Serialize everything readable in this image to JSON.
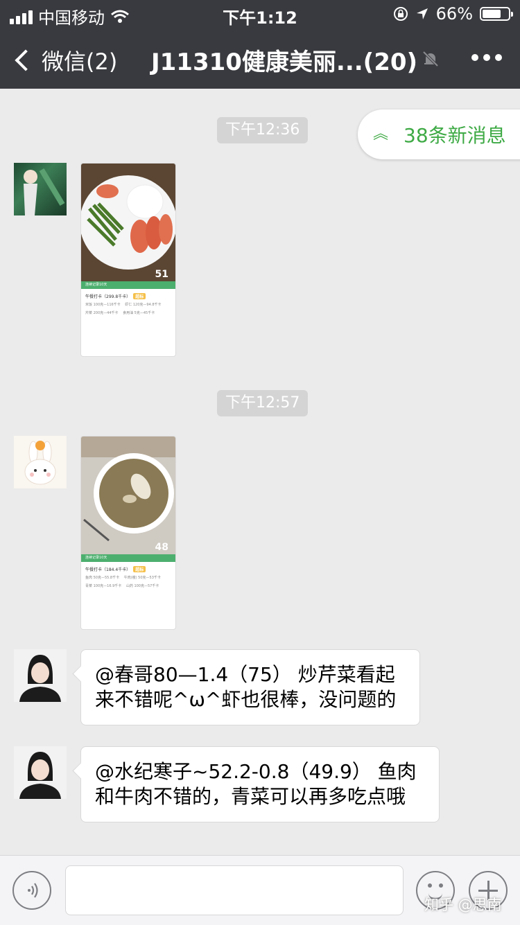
{
  "status_bar": {
    "carrier": "中国移动",
    "time": "下午1:12",
    "battery": "66%",
    "battery_level": 0.66
  },
  "nav": {
    "back_label": "微信(2)",
    "title": "J11310健康美丽...(20)"
  },
  "new_messages_banner": "38条新消息",
  "messages": [
    {
      "timestamp": "下午12:36",
      "type": "image",
      "card_title": "午餐打卡（299.8千卡）",
      "card_badge": "超标",
      "score": "51",
      "streak": "连续记录10天",
      "lines": [
        "米饭 100克—116千卡 　虾仁 120克—94.8千卡",
        "芹菜 200克—44千卡 　食用油 5克—45千卡"
      ]
    },
    {
      "timestamp": "下午12:57",
      "type": "image",
      "card_title": "午餐打卡（184.4千卡）",
      "card_badge": "超标",
      "score": "48",
      "streak": "连续记录10天",
      "lines": [
        "鱼肉 50克—55.8千卡 　牛肉(瘦) 50克—53千卡",
        "青菜 100克—16.9千卡 　山药 100克—57千卡"
      ]
    },
    {
      "type": "text",
      "text": "@春哥80—1.4（75） 炒芹菜看起来不错呢^ω^虾也很棒，没问题的"
    },
    {
      "type": "text",
      "text": "@水纪寒子~52.2-0.8（49.9） 鱼肉和牛肉不错的，青菜可以再多吃点哦"
    }
  ],
  "watermark": "知乎 @思南",
  "colors": {
    "nav_bg": "#393a3f",
    "chat_bg": "#ebebeb",
    "accent_green": "#3eaa45"
  }
}
